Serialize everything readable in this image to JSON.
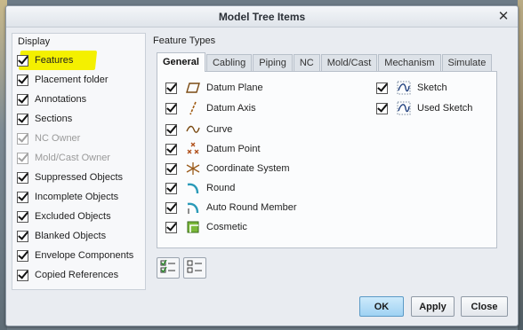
{
  "dialog": {
    "title": "Model Tree Items",
    "close_glyph": "✕"
  },
  "display": {
    "label": "Display",
    "items": [
      {
        "label": "Features",
        "checked": true,
        "enabled": true
      },
      {
        "label": "Placement folder",
        "checked": true,
        "enabled": true
      },
      {
        "label": "Annotations",
        "checked": true,
        "enabled": true
      },
      {
        "label": "Sections",
        "checked": true,
        "enabled": true
      },
      {
        "label": "NC Owner",
        "checked": true,
        "enabled": false
      },
      {
        "label": "Mold/Cast Owner",
        "checked": true,
        "enabled": false
      },
      {
        "label": "Suppressed Objects",
        "checked": true,
        "enabled": true
      },
      {
        "label": "Incomplete Objects",
        "checked": true,
        "enabled": true
      },
      {
        "label": "Excluded Objects",
        "checked": true,
        "enabled": true
      },
      {
        "label": "Blanked Objects",
        "checked": true,
        "enabled": true
      },
      {
        "label": "Envelope Components",
        "checked": true,
        "enabled": true
      },
      {
        "label": "Copied References",
        "checked": true,
        "enabled": true
      }
    ],
    "highlight_color": "#f4f000"
  },
  "feature_types": {
    "label": "Feature Types",
    "tabs": [
      {
        "label": "General",
        "active": true
      },
      {
        "label": "Cabling"
      },
      {
        "label": "Piping"
      },
      {
        "label": "NC"
      },
      {
        "label": "Mold/Cast"
      },
      {
        "label": "Mechanism"
      },
      {
        "label": "Simulate"
      }
    ],
    "general_items_left": [
      {
        "label": "Datum Plane",
        "icon": "datum-plane-icon",
        "checked": true
      },
      {
        "label": "Datum Axis",
        "icon": "datum-axis-icon",
        "checked": true
      },
      {
        "label": "Curve",
        "icon": "curve-icon",
        "checked": true
      },
      {
        "label": "Datum Point",
        "icon": "datum-point-icon",
        "checked": true
      },
      {
        "label": "Coordinate System",
        "icon": "coordinate-system-icon",
        "checked": true
      },
      {
        "label": "Round",
        "icon": "round-icon",
        "checked": true
      },
      {
        "label": "Auto Round Member",
        "icon": "auto-round-member-icon",
        "checked": true
      },
      {
        "label": "Cosmetic",
        "icon": "cosmetic-icon",
        "checked": true
      }
    ],
    "general_items_right": [
      {
        "label": "Sketch",
        "icon": "sketch-icon",
        "checked": true
      },
      {
        "label": "Used Sketch",
        "icon": "used-sketch-icon",
        "checked": true
      }
    ]
  },
  "buttons": {
    "ok": "OK",
    "apply": "Apply",
    "close": "Close"
  },
  "colors": {
    "accent": "#9fd2f3",
    "dialog_bg": "#e9ecf1"
  }
}
